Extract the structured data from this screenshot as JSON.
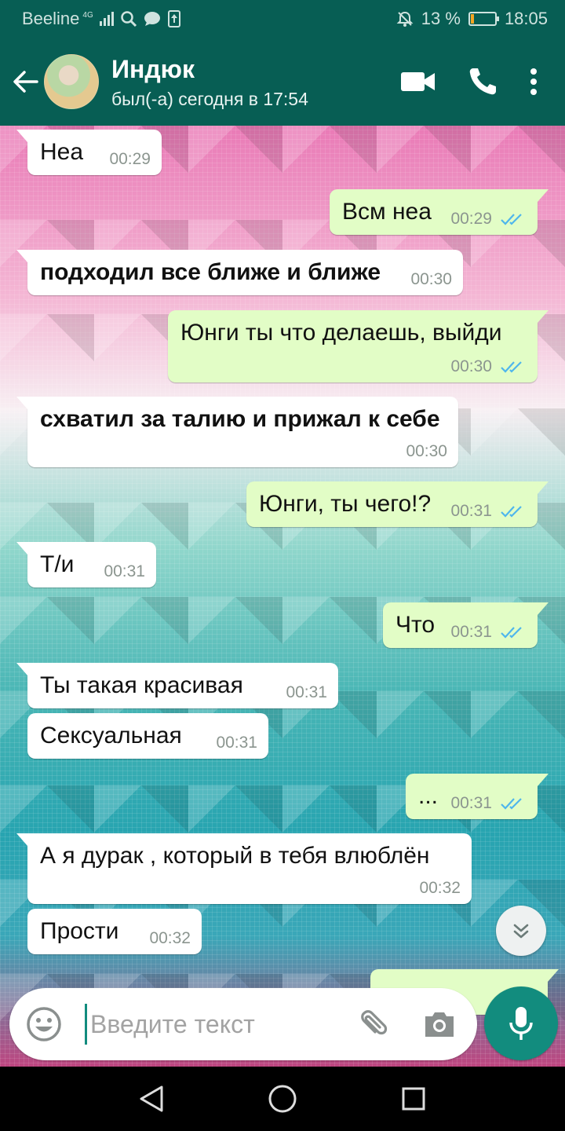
{
  "status_bar": {
    "carrier": "Beeline",
    "network": "4G",
    "battery_percent": "13 %",
    "battery_level": 0.13,
    "time": "18:05"
  },
  "header": {
    "name": "Индюк",
    "last_seen": "был(-а) сегодня в 17:54"
  },
  "messages": [
    {
      "dir": "in",
      "text": "Неа",
      "time": "00:29",
      "bold": false
    },
    {
      "dir": "out",
      "text": "Всм неа",
      "time": "00:29"
    },
    {
      "dir": "in",
      "text": "подходил все ближе и ближе",
      "time": "00:30",
      "bold": true
    },
    {
      "dir": "out",
      "text": "Юнги ты что делаешь, выйди",
      "time": "00:30"
    },
    {
      "dir": "in",
      "text": "схватил за талию и прижал к себе",
      "time": "00:30",
      "bold": true
    },
    {
      "dir": "out",
      "text": "Юнги, ты чего!?",
      "time": "00:31"
    },
    {
      "dir": "in",
      "text": "Т/и",
      "time": "00:31",
      "bold": false
    },
    {
      "dir": "out",
      "text": "Что",
      "time": "00:31"
    },
    {
      "dir": "in",
      "text": "Ты такая красивая",
      "time": "00:31",
      "bold": false
    },
    {
      "dir": "in",
      "text": "Сексуальная",
      "time": "00:31",
      "bold": false
    },
    {
      "dir": "out",
      "text": "...",
      "time": "00:31"
    },
    {
      "dir": "in",
      "text": "А я дурак , который в тебя влюблён",
      "time": "00:32",
      "bold": false
    },
    {
      "dir": "in",
      "text": "Прости",
      "time": "00:32",
      "bold": false
    }
  ],
  "composer": {
    "placeholder": "Введите текст"
  },
  "colors": {
    "header": "#075e54",
    "accent": "#128c7e",
    "outgoing_bubble": "#e2fdc6",
    "incoming_bubble": "#ffffff",
    "read_ticks": "#4fb6ec"
  },
  "icons": {
    "back": "arrow-left-icon",
    "video": "video-call-icon",
    "call": "phone-icon",
    "menu": "more-vert-icon",
    "emoji": "emoji-icon",
    "attach": "paperclip-icon",
    "camera": "camera-icon",
    "mic": "mic-icon",
    "scroll": "double-chevron-down-icon"
  }
}
